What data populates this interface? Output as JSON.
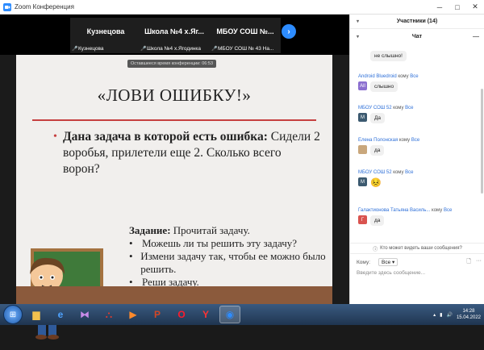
{
  "window": {
    "title": "Zoom Конференция"
  },
  "thumbnails": [
    {
      "name": "Кузнецова",
      "label": "Кузнецова"
    },
    {
      "name": "Школа №4 х.Яг...",
      "label": "Школа №4 х.Ягодинка"
    },
    {
      "name": "МБОУ СОШ №...",
      "label": "МБОУ СОШ № 43 На..."
    }
  ],
  "meeting": {
    "time_notice": "Оставшееся время конференции: 06:53"
  },
  "slide": {
    "title": "«ЛОВИ ОШИБКУ!»",
    "task_bold": "Дана задача в которой есть ошибка:",
    "task_rest": "Сидели 2 воробья, прилетели еще 2. Сколько всего ворон?",
    "assign_label": "Задание:",
    "assign_label_rest": "Прочитай задачу.",
    "assign_items": [
      "Можешь ли ты решить эту задачу?",
      "Измени задачу так, чтобы ее можно было решить.",
      "Реши задачу."
    ]
  },
  "panel": {
    "participants_title": "Участники (14)",
    "chat_title": "Чат",
    "messages": [
      {
        "sender": "",
        "to": "",
        "text": "не слышно!",
        "avatar": "",
        "avatar_color": ""
      },
      {
        "sender": "Android Bluedroid",
        "to": "Все",
        "text": "слышно",
        "avatar": "All",
        "avatar_color": "#8b6fd0"
      },
      {
        "sender": "МБОУ СОШ 52",
        "to": "Все",
        "text": "Да",
        "avatar": "М",
        "avatar_color": "#3c5a70"
      },
      {
        "sender": "Елена Полонская",
        "to": "Все",
        "text": "да",
        "avatar": "",
        "avatar_color": "#c9a77c"
      },
      {
        "sender": "МБОУ СОШ 52",
        "to": "Все",
        "text": "😣",
        "avatar": "М",
        "avatar_color": "#3c5a70"
      },
      {
        "sender": "Галактионова Татьяна Василь...",
        "to": "Все",
        "text": "да",
        "avatar": "Г",
        "avatar_color": "#d9534f"
      }
    ],
    "to_word": "кому",
    "who_sees": "Кто может видеть ваши сообщения?",
    "to_label": "Кому:",
    "to_value": "Все",
    "input_placeholder": "Введите здесь сообщение..."
  },
  "taskbar": {
    "time": "14:28",
    "date": "15.04.2022"
  },
  "icons": {
    "app": "zoom-icon",
    "minimize": "minimize-icon",
    "maximize": "maximize-icon",
    "close": "close-icon",
    "next": "chevron-right-icon",
    "mic_muted": "mic-muted-icon"
  }
}
